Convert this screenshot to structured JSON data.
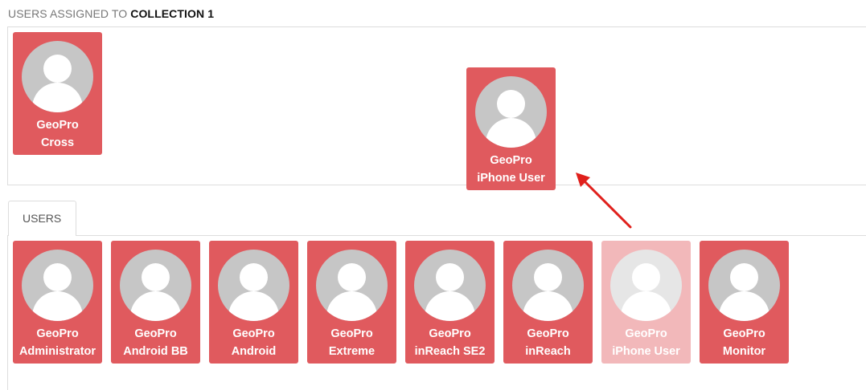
{
  "header": {
    "prefix": "USERS ASSIGNED TO",
    "collection": "COLLECTION 1"
  },
  "assigned_users": [
    {
      "line1": "GeoPro",
      "line2": "Cross"
    },
    {
      "line1": "GeoPro",
      "line2": "iPhone User"
    }
  ],
  "tabs": [
    {
      "label": "USERS"
    }
  ],
  "users": [
    {
      "line1": "GeoPro",
      "line2": "Administrator"
    },
    {
      "line1": "GeoPro",
      "line2": "Android BB"
    },
    {
      "line1": "GeoPro",
      "line2": "Android"
    },
    {
      "line1": "GeoPro",
      "line2": "Extreme"
    },
    {
      "line1": "GeoPro",
      "line2": "inReach SE2"
    },
    {
      "line1": "GeoPro",
      "line2": "inReach"
    },
    {
      "line1": "GeoPro",
      "line2": "iPhone User"
    },
    {
      "line1": "GeoPro",
      "line2": "Monitor"
    }
  ],
  "colors": {
    "card": "#e05a5e",
    "card_faded": "#f2b8ba",
    "arrow": "#e0201c"
  },
  "icons": {
    "avatar": "user-silhouette-icon",
    "arrow": "red-arrow-icon"
  }
}
